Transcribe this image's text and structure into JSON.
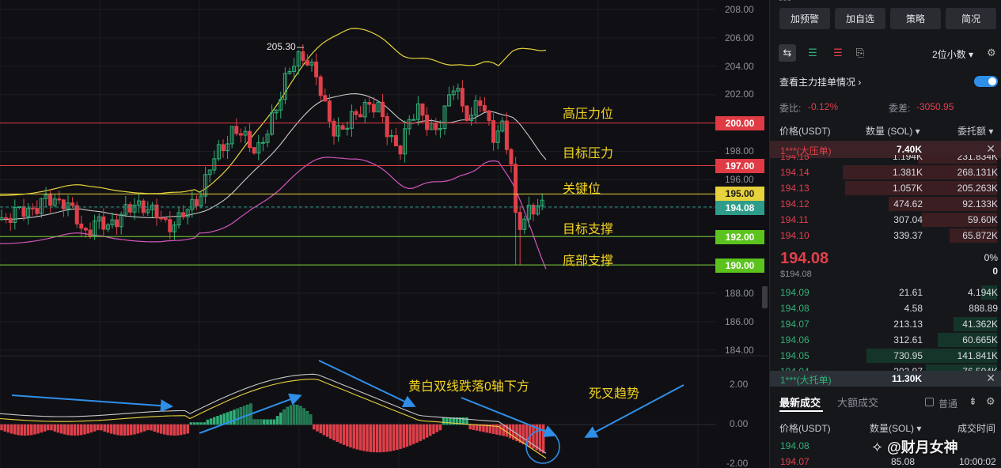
{
  "colors": {
    "up": "#2fb177",
    "down": "#e0404a",
    "yellow_line": "#e6d23c",
    "white_line": "#c8c8c8",
    "pink_line": "#d455c0",
    "red_level": "#e03b44",
    "yellow_level": "#e6d23c",
    "green_level": "#7bd23c",
    "arrow_blue": "#2f8fe8"
  },
  "price_axis": {
    "labels": [
      "208.00",
      "206.00",
      "204.00",
      "202.00",
      "198.00",
      "196.00",
      "188.00",
      "186.00",
      "184.00"
    ],
    "tags": [
      {
        "text": "200.00",
        "kind": "red"
      },
      {
        "text": "197.00",
        "kind": "red"
      },
      {
        "text": "195.00",
        "kind": "yellow"
      },
      {
        "text": "194.08",
        "kind": "teal"
      },
      {
        "text": "192.00",
        "kind": "green"
      },
      {
        "text": "190.00",
        "kind": "green"
      }
    ]
  },
  "macd_axis": {
    "labels": [
      "2.00",
      "0.00",
      "-2.00"
    ]
  },
  "annotations": {
    "high_label": "205.30",
    "level_high_pressure": "高压力位",
    "level_target_pressure": "目标压力",
    "level_key": "关键位",
    "level_target_support": "目标支撑",
    "level_bottom_support": "底部支撑",
    "macd_note": "黄白双线跌落0轴下方",
    "death_cross": "死叉趋势"
  },
  "chart_data": {
    "type": "candlestick",
    "price_levels": [
      200.0,
      197.0,
      195.0,
      194.08,
      192.0,
      190.0
    ],
    "high_marker": 205.3,
    "ylim": [
      183,
      209
    ],
    "macd_ylim": [
      -2.2,
      2.6
    ],
    "macd_ticks": [
      2.0,
      0.0,
      -2.0
    ]
  },
  "panel": {
    "buttons": [
      "加预警",
      "加自选",
      "策略",
      "简况"
    ],
    "decimals": "2位小数",
    "show_main_orders": "查看主力挂单情况",
    "ratio_label": "委比:",
    "ratio_value": "-0.12%",
    "diff_label": "委差:",
    "diff_value": "-3050.95",
    "col_price": "价格(USDT)",
    "col_qty": "数量 (SOL)",
    "col_amount": "委托额",
    "big_sell_label": "1***(大压单)",
    "big_sell_value": "7.40K",
    "asks": [
      {
        "price": "194.15",
        "qty": "1.194K",
        "amt": "231.834K",
        "depth": 0.4
      },
      {
        "price": "194.14",
        "qty": "1.381K",
        "amt": "268.131K",
        "depth": 0.78
      },
      {
        "price": "194.13",
        "qty": "1.057K",
        "amt": "205.263K",
        "depth": 0.77
      },
      {
        "price": "194.12",
        "qty": "474.62",
        "amt": "92.133K",
        "depth": 0.55
      },
      {
        "price": "194.11",
        "qty": "307.04",
        "amt": "59.60K",
        "depth": 0.38
      },
      {
        "price": "194.10",
        "qty": "339.37",
        "amt": "65.872K",
        "depth": 0.24
      }
    ],
    "last_price": "194.08",
    "last_price_usd": "$194.08",
    "change_pct": "0%",
    "change_abs": "0",
    "bids": [
      {
        "price": "194.09",
        "qty": "21.61",
        "amt": "4.194K",
        "depth": 0.08
      },
      {
        "price": "194.08",
        "qty": "4.58",
        "amt": "888.89",
        "depth": 0.0
      },
      {
        "price": "194.07",
        "qty": "213.13",
        "amt": "41.362K",
        "depth": 0.22
      },
      {
        "price": "194.06",
        "qty": "312.61",
        "amt": "60.665K",
        "depth": 0.3
      },
      {
        "price": "194.05",
        "qty": "730.95",
        "amt": "141.841K",
        "depth": 0.66
      },
      {
        "price": "194.04",
        "qty": "393.97",
        "amt": "76.504K",
        "depth": 0.36
      }
    ],
    "big_buy_label": "1***(大托单)",
    "big_buy_value": "11.30K",
    "trades_tab_latest": "最新成交",
    "trades_tab_large": "大额成交",
    "trades_filter": "普通",
    "trades_col_price": "价格(USDT)",
    "trades_col_qty": "数量(SOL)",
    "trades_col_time": "成交时间",
    "trades": [
      {
        "price": "194.08",
        "qty": "",
        "time": ""
      },
      {
        "price": "194.07",
        "qty": "85.08",
        "time": "10:00:02"
      }
    ],
    "watermark": "@财月女神"
  }
}
